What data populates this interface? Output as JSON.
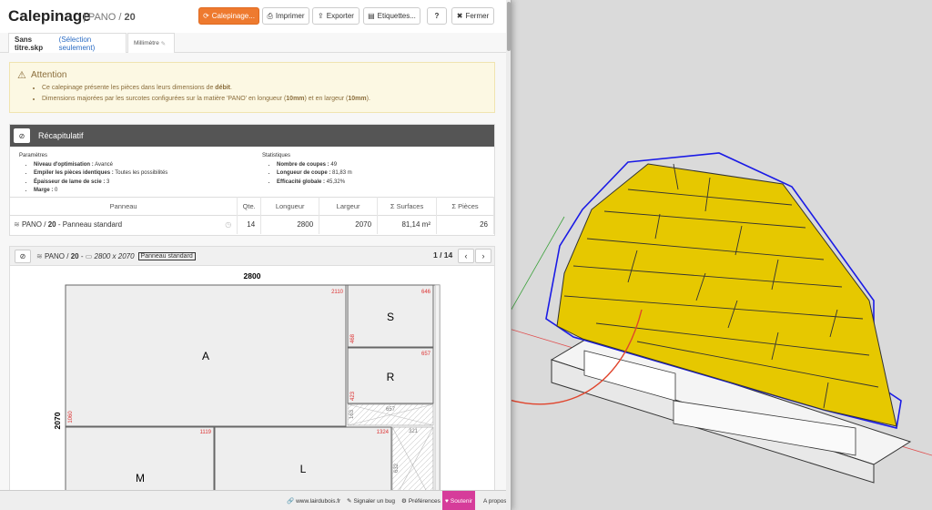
{
  "app": {
    "title": "Calepinage",
    "subtitle_material": "PANO",
    "subtitle_thickness": "20"
  },
  "toolbar": {
    "calepinage": "Calepinage...",
    "print": "Imprimer",
    "export": "Exporter",
    "labels": "Etiquettes...",
    "help": "?",
    "close": "Fermer"
  },
  "tabs": {
    "file": "Sans titre.skp",
    "selection": "(Sélection seulement)",
    "unit": "Millimètre"
  },
  "alert": {
    "title": "Attention",
    "line1_pre": "Ce calepinage présente les pièces dans leurs dimensions de ",
    "line1_bold": "débit",
    "line1_post": ".",
    "line2_pre": "Dimensions majorées par les surcotes configurées sur la matière 'PANO' en longueur (",
    "line2_b1": "10mm",
    "line2_mid": ") et en largeur (",
    "line2_b2": "10mm",
    "line2_post": ")."
  },
  "summary": {
    "title": "Récapitulatif",
    "params_title": "Paramètres",
    "params": [
      {
        "k": "Niveau d'optimisation :",
        "v": " Avancé"
      },
      {
        "k": "Empiler les pièces identiques :",
        "v": " Toutes les possibilités"
      },
      {
        "k": "Épaisseur de lame de scie :",
        "v": " 3"
      },
      {
        "k": "Marge :",
        "v": " 0"
      }
    ],
    "stats_title": "Statistiques",
    "stats": [
      {
        "k": "Nombre de coupes :",
        "v": " 49"
      },
      {
        "k": "Longueur de coupe :",
        "v": " 81,83 m"
      },
      {
        "k": "Efficacité globale :",
        "v": " 45,32%"
      }
    ],
    "columns": [
      "Panneau",
      "Qte.",
      "Longueur",
      "Largeur",
      "Σ Surfaces",
      "Σ Pièces"
    ],
    "row": {
      "material": "PANO",
      "sep": " / ",
      "thickness": "20",
      "name": " - Panneau standard",
      "qty": "14",
      "length": "2800",
      "width": "2070",
      "surface": "81,14 m²",
      "pieces": "26"
    }
  },
  "sheet": {
    "material": "PANO",
    "thickness": "20",
    "size": "2800 x 2070",
    "tag": "Panneau standard",
    "page": "1 / 14",
    "prev": "‹",
    "next": "›",
    "dim_width": "2800",
    "dim_height": "2070"
  },
  "pieces": [
    {
      "label": "A",
      "length": "2110",
      "width": "1060"
    },
    {
      "label": "S",
      "length": "646",
      "width": "468"
    },
    {
      "label": "R",
      "length": "657",
      "width": "423"
    },
    {
      "label": "M",
      "length": "1119"
    },
    {
      "label": "L",
      "length": "1324"
    }
  ],
  "offcuts": [
    "657",
    "163",
    "321",
    "632"
  ],
  "footer": {
    "site": "www.lairdubois.fr",
    "report": "Signaler un bug",
    "prefs": "Préférences",
    "support": "Soutenir",
    "about": "A propos"
  },
  "colors": {
    "accent": "#ee7a2f",
    "panel_dark": "#555555",
    "alert_bg": "#fcf8e3",
    "piece_yellow": "#e6c800",
    "edge_blue": "#1a1ae6",
    "support_pink": "#d63c9a"
  }
}
